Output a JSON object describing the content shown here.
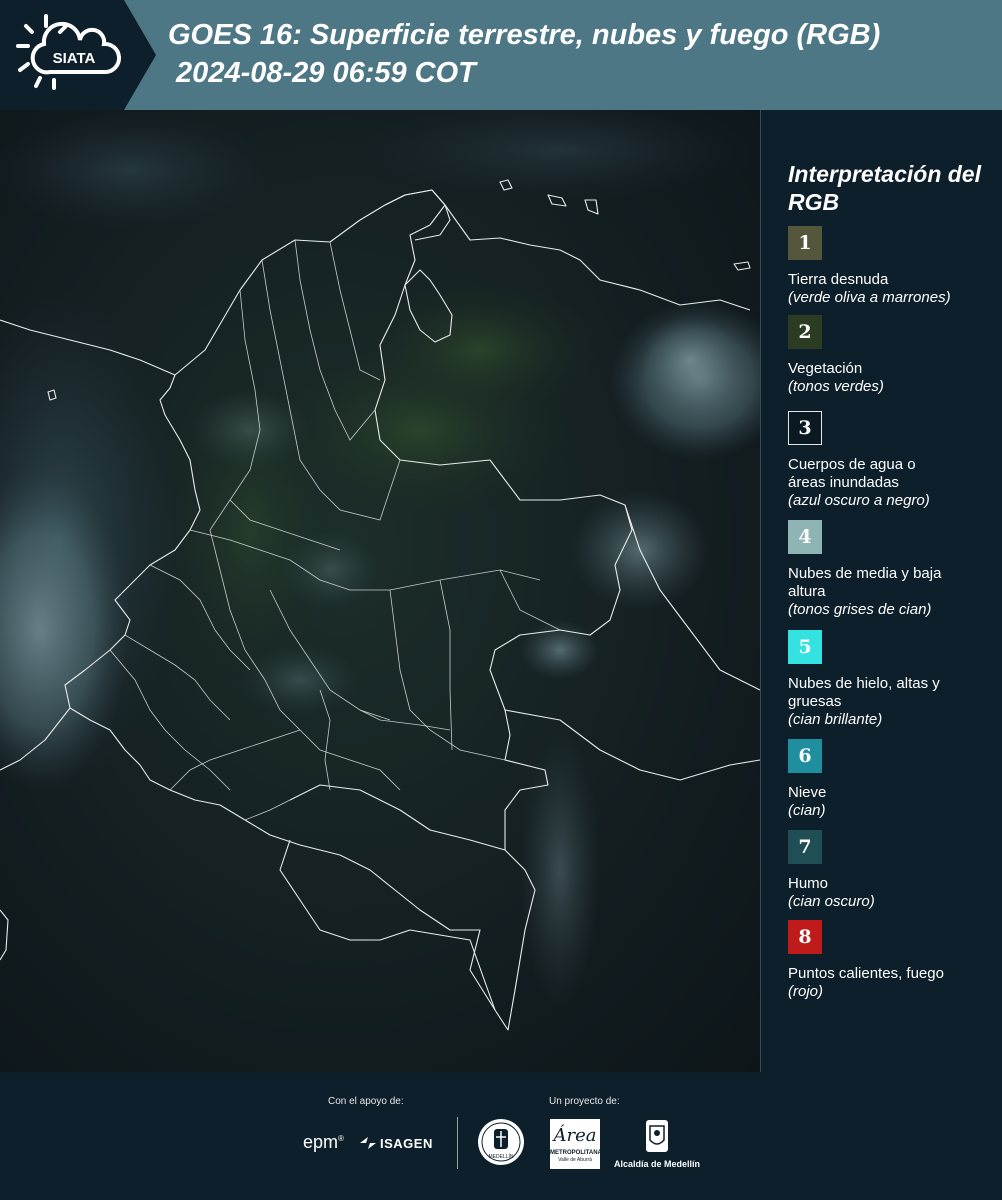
{
  "header": {
    "logo_text": "SIATA",
    "title_line1": "GOES 16: Superficie terrestre, nubes y fuego (RGB)",
    "title_line2": " 2024-08-29 06:59 COT"
  },
  "legend": {
    "title": "Interpretación del RGB",
    "items": [
      {
        "number": "1",
        "color": "#55573c",
        "name": "Tierra desnuda",
        "desc": "(verde oliva a marrones)"
      },
      {
        "number": "2",
        "color": "#2c3c22",
        "name": "Vegetación",
        "desc": "(tonos verdes)"
      },
      {
        "number": "3",
        "color": "#0b1a22",
        "name": "Cuerpos de agua o áreas inundadas",
        "desc": "(azul oscuro a negro)"
      },
      {
        "number": "4",
        "color": "#8fb4b4",
        "name": "Nubes de media y baja altura",
        "desc": "(tonos grises de cian)"
      },
      {
        "number": "5",
        "color": "#34e2e2",
        "name": "Nubes de hielo, altas y gruesas",
        "desc": "(cian brillante)"
      },
      {
        "number": "6",
        "color": "#1f8fa0",
        "name": "Nieve",
        "desc": "(cian)"
      },
      {
        "number": "7",
        "color": "#1f4f54",
        "name": "Humo",
        "desc": "(cian oscuro)"
      },
      {
        "number": "8",
        "color": "#c01b1b",
        "name": "Puntos calientes, fuego",
        "desc": "(rojo)"
      }
    ]
  },
  "footer": {
    "support_label": "Con el apoyo de:",
    "project_label": "Un proyecto de:",
    "sponsor_epm": "epm",
    "sponsor_isagen": "ISAGEN",
    "area_text": "Área",
    "area_subtext": "METROPOLITANA",
    "area_subtext2": "Valle de Aburrá",
    "alcaldia_text": "Alcaldía de Medellín",
    "seal_text": "MEDELLÍN"
  }
}
